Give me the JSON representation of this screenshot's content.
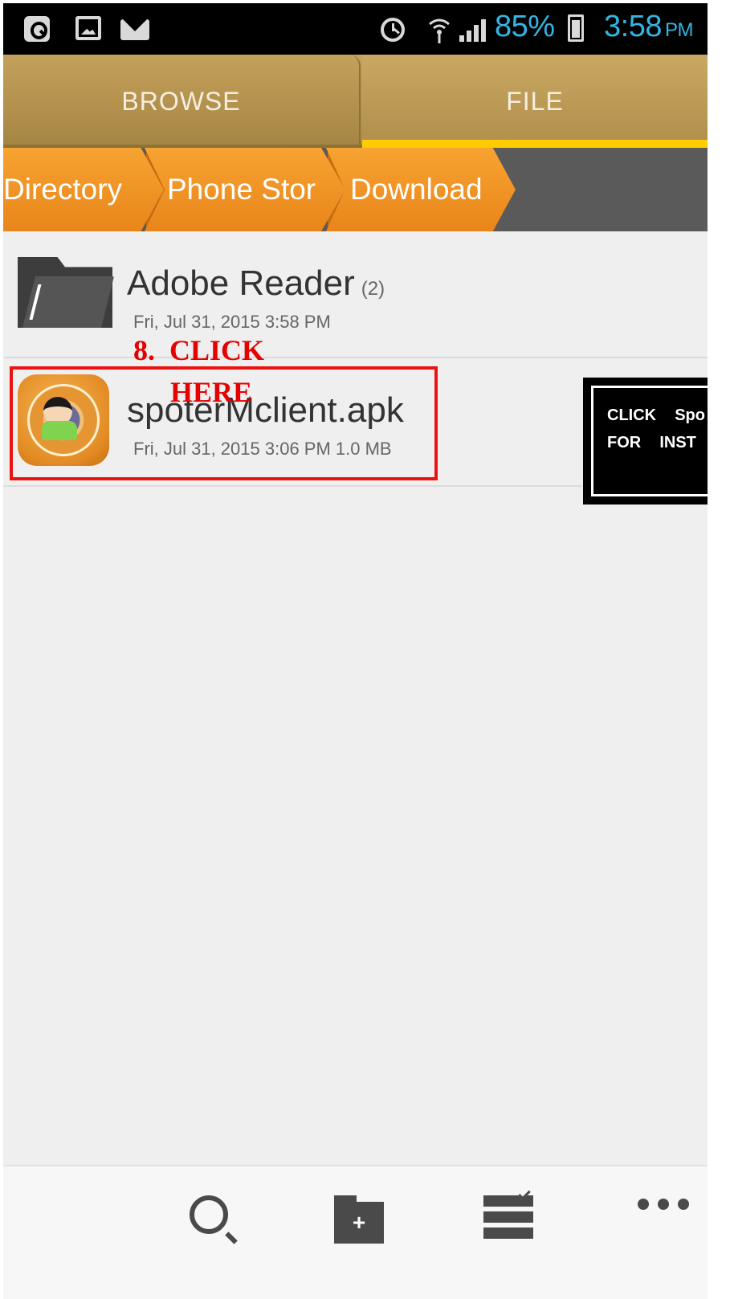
{
  "status_bar": {
    "battery": "85%",
    "time": "3:58",
    "ampm": "PM",
    "left_icons": [
      "q-app-icon",
      "gallery-icon",
      "mail-icon"
    ],
    "right_icons": [
      "alarm-icon",
      "wifi-icon",
      "signal-icon",
      "battery-icon"
    ]
  },
  "tabs": [
    {
      "label": "BROWSE",
      "active": false
    },
    {
      "label": "FILE",
      "active": true
    }
  ],
  "colors": {
    "tab_indicator": "#ffcc00",
    "breadcrumb": "#f29327",
    "status_text": "#33b5e5",
    "annotation_red": "#e60000"
  },
  "breadcrumb": [
    "Directory",
    "Phone Stor",
    "Download"
  ],
  "files": [
    {
      "name": "Adobe Reader",
      "count": "(2)",
      "meta": "Fri, Jul 31, 2015 3:58 PM",
      "icon": "folder-icon"
    },
    {
      "name": "spoterMclient.apk",
      "meta": "Fri, Jul 31, 2015 3:06 PM 1.0 MB",
      "icon": "apk-app-icon"
    }
  ],
  "annotation": {
    "line1": "8.  CLICK",
    "line2": "HERE"
  },
  "callout": {
    "line1": "CLICK  Spo",
    "line2": "FOR  INST"
  },
  "bottom_bar": {
    "icons": [
      "search-icon",
      "new-folder-icon",
      "manage-icon",
      "more-icon"
    ],
    "new_folder_glyph": "+"
  }
}
